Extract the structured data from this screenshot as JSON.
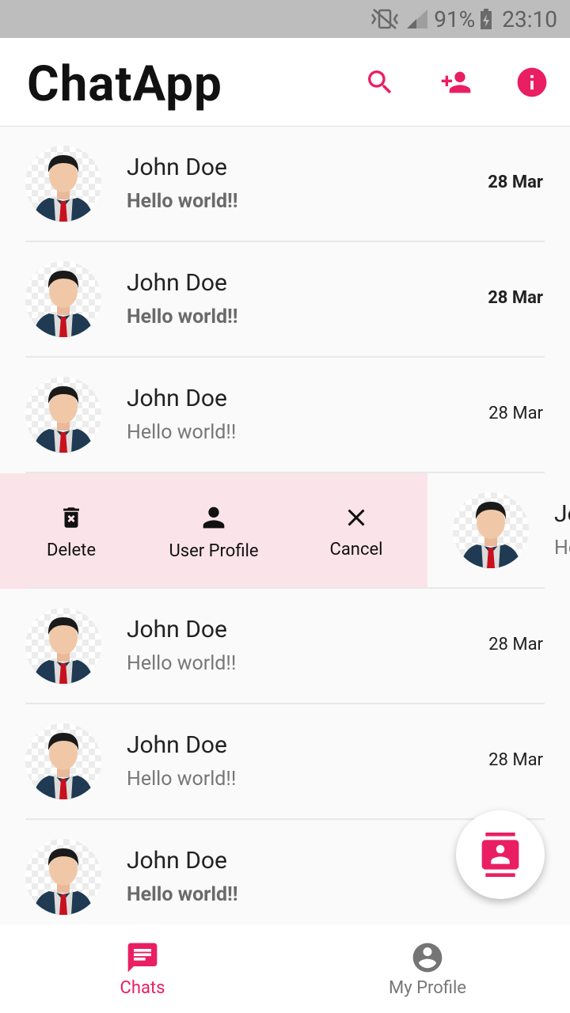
{
  "status_bar": {
    "battery": "91%",
    "time": "23:10"
  },
  "app_bar": {
    "title": "ChatApp",
    "icons": [
      "search-icon",
      "add-user-icon",
      "info-icon"
    ]
  },
  "colors": {
    "accent": "#e91e63",
    "swipe_bg": "#fbe3ea"
  },
  "chats": [
    {
      "name": "John Doe",
      "message": "Hello world!!",
      "date": "28 Mar",
      "unread": true
    },
    {
      "name": "John Doe",
      "message": "Hello world!!",
      "date": "28 Mar",
      "unread": true
    },
    {
      "name": "John Doe",
      "message": "Hello world!!",
      "date": "28 Mar",
      "unread": false
    },
    {
      "name": "Jo",
      "message": "He",
      "date": "",
      "unread": false
    },
    {
      "name": "John Doe",
      "message": "Hello world!!",
      "date": "28 Mar",
      "unread": false
    },
    {
      "name": "John Doe",
      "message": "Hello world!!",
      "date": "28 Mar",
      "unread": false
    },
    {
      "name": "John Doe",
      "message": "Hello world!!",
      "date": "",
      "unread": true
    }
  ],
  "swipe_actions": {
    "delete_label": "Delete",
    "profile_label": "User Profile",
    "cancel_label": "Cancel"
  },
  "bottom_nav": {
    "chats_label": "Chats",
    "profile_label": "My Profile"
  }
}
